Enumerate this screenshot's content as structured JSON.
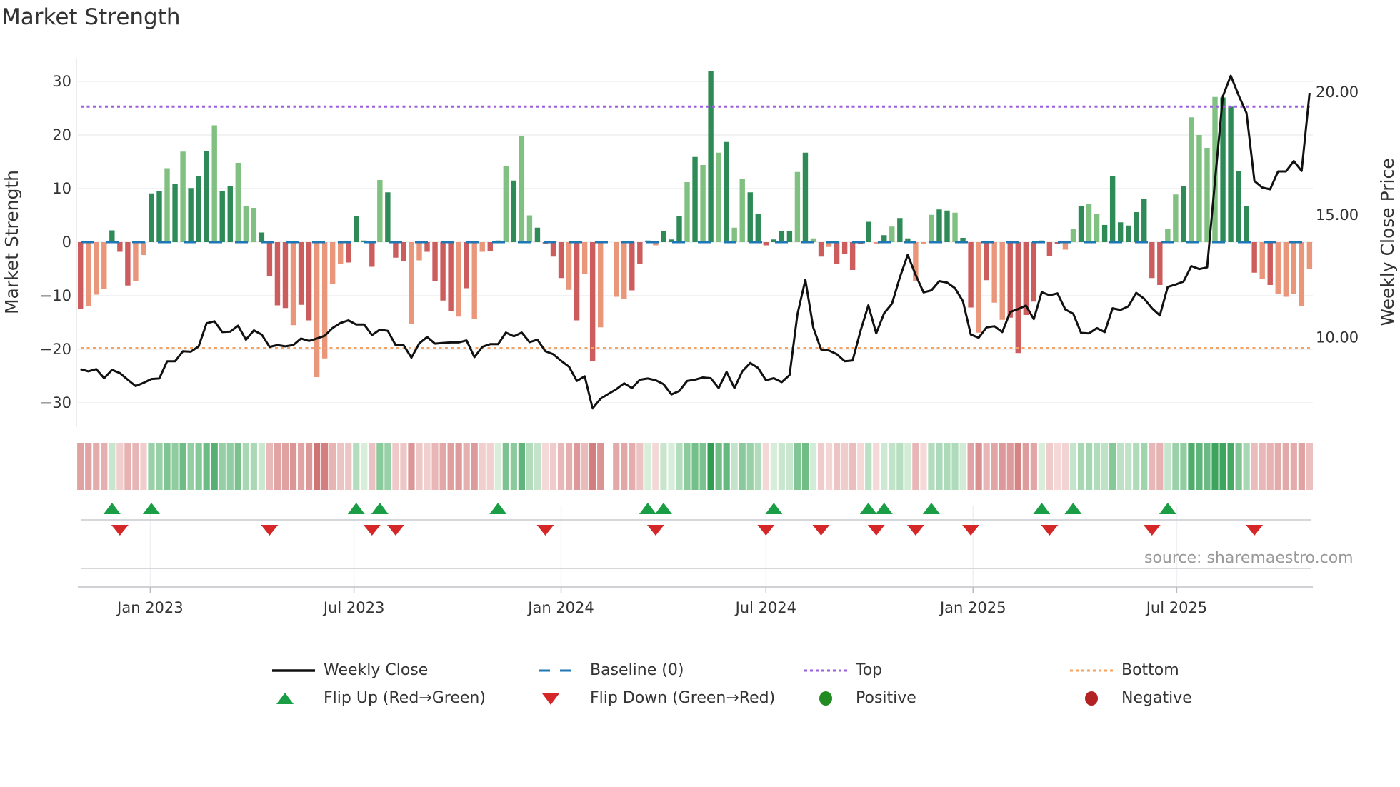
{
  "header": {
    "title": "Market Strength"
  },
  "source": "source: sharemaestro.com",
  "colors": {
    "pos_dark": "#2e8b57",
    "pos_light": "#80c080",
    "neg_dark": "#cd5c5c",
    "neg_light": "#e9967a",
    "price": "#111111",
    "baseline": "#1f77b4",
    "top": "#9b5fe0",
    "bottom": "#f4a261",
    "flip_up": "#1a9e45",
    "flip_down": "#d62728",
    "positive": "#228b22",
    "negative": "#b22222"
  },
  "legend": {
    "weekly_close": "Weekly Close",
    "baseline": "Baseline (0)",
    "top": "Top",
    "bottom": "Bottom",
    "flip_up": "Flip Up (Red→Green)",
    "flip_down": "Flip Down (Green→Red)",
    "positive": "Positive",
    "negative": "Negative"
  },
  "chart_data": {
    "type": "bar",
    "title": "Market Strength",
    "ylabel": "Market Strength",
    "y2label": "Weekly Close Price",
    "ylim": [
      -33,
      33
    ],
    "y2lim": [
      6.4,
      21.5
    ],
    "yticks": [
      30,
      20,
      10,
      0,
      -10,
      -20,
      -30
    ],
    "y2ticks": [
      "20.00",
      "15.00",
      "10.00"
    ],
    "x_start": "2022-10-31",
    "x_interval_days": 7,
    "xticks": [
      {
        "date": "2023-01-01",
        "label": "Jan 2023"
      },
      {
        "date": "2023-07-01",
        "label": "Jul 2023"
      },
      {
        "date": "2024-01-01",
        "label": "Jan 2024"
      },
      {
        "date": "2024-07-01",
        "label": "Jul 2024"
      },
      {
        "date": "2025-01-01",
        "label": "Jan 2025"
      },
      {
        "date": "2025-07-01",
        "label": "Jul 2025"
      }
    ],
    "top_level": 25.3,
    "bottom_level": -19.8,
    "baseline": 0,
    "strength": [
      -12.4,
      -11.9,
      -9.8,
      -8.8,
      2.2,
      -1.8,
      -8.1,
      -7.3,
      -2.4,
      9.1,
      9.5,
      13.8,
      10.8,
      16.9,
      10.1,
      12.4,
      17.0,
      21.8,
      9.6,
      10.5,
      14.8,
      6.8,
      6.4,
      1.8,
      -6.4,
      -11.8,
      -12.3,
      -15.5,
      -11.7,
      -14.6,
      -25.2,
      -21.7,
      -7.8,
      -4.1,
      -3.8,
      4.9,
      0.3,
      -4.6,
      11.6,
      9.3,
      -2.9,
      -3.6,
      -15.2,
      -3.4,
      -1.8,
      -7.2,
      -10.9,
      -12.9,
      -13.9,
      -8.6,
      -14.3,
      -1.8,
      -1.7,
      0.3,
      14.2,
      11.5,
      19.8,
      5.0,
      2.7,
      -0.3,
      -2.7,
      -6.7,
      -8.9,
      -14.6,
      -6.0,
      -22.2,
      -15.9,
      null,
      -10.2,
      -10.6,
      -9.0,
      -4.0,
      0.3,
      -0.6,
      2.1,
      0.5,
      4.8,
      11.2,
      15.9,
      14.4,
      31.9,
      16.7,
      18.7,
      2.7,
      11.8,
      9.3,
      5.2,
      -0.6,
      0.5,
      2.0,
      2.0,
      13.1,
      16.7,
      0.7,
      -2.7,
      -0.9,
      -4.0,
      -2.2,
      -5.2,
      -0.3,
      3.8,
      -0.4,
      1.3,
      2.9,
      4.5,
      0.7,
      -7.2,
      -0.3,
      5.1,
      6.1,
      5.9,
      5.5,
      0.8,
      -12.2,
      -16.9,
      -7.1,
      -11.3,
      -14.5,
      -14.1,
      -20.7,
      -13.6,
      -11.1,
      0.3,
      -2.6,
      -0.3,
      -1.4,
      2.5,
      6.8,
      7.1,
      5.2,
      3.2,
      12.4,
      3.7,
      3.1,
      5.6,
      8.0,
      -6.7,
      -8.0,
      2.5,
      8.9,
      10.4,
      23.3,
      20.0,
      17.6,
      27.1,
      27.0,
      25.3,
      13.3,
      6.8,
      -5.7,
      -6.8,
      -8.0,
      -9.7,
      -10.2,
      -9.7,
      -12.0,
      -5.0
    ],
    "shade": "dllldddllddldldddlddlllddddlddllllddddldddllddddldllddldllddddldldldlldddldddldldldllddddddldldldddddldldd lllddlddldlldddddddlldllddddddddlldlllldddddldl",
    "weekly_close": [
      8.71,
      8.62,
      8.71,
      8.34,
      8.68,
      8.55,
      8.28,
      8.02,
      8.15,
      8.31,
      8.33,
      9.03,
      9.03,
      9.44,
      9.42,
      9.64,
      10.58,
      10.66,
      10.22,
      10.24,
      10.48,
      9.91,
      10.29,
      10.12,
      9.62,
      9.69,
      9.64,
      9.69,
      9.96,
      9.86,
      9.96,
      10.07,
      10.39,
      10.59,
      10.7,
      10.53,
      10.53,
      10.1,
      10.32,
      10.27,
      9.69,
      9.69,
      9.18,
      9.76,
      10.02,
      9.75,
      9.78,
      9.8,
      9.8,
      9.88,
      9.2,
      9.62,
      9.73,
      9.73,
      10.2,
      10.05,
      10.2,
      9.81,
      9.91,
      9.44,
      9.32,
      9.05,
      8.81,
      8.23,
      8.42,
      7.11,
      7.5,
      7.7,
      7.89,
      8.13,
      7.94,
      8.28,
      8.33,
      8.26,
      8.1,
      7.68,
      7.82,
      8.23,
      8.28,
      8.37,
      8.34,
      7.94,
      8.6,
      7.94,
      8.62,
      8.96,
      8.76,
      8.26,
      8.34,
      8.18,
      8.47,
      10.95,
      12.35,
      10.41,
      9.51,
      9.47,
      9.32,
      9.03,
      9.06,
      10.27,
      11.31,
      10.17,
      10.99,
      11.38,
      12.45,
      13.37,
      12.55,
      11.84,
      11.92,
      12.3,
      12.24,
      12.01,
      11.48,
      10.12,
      9.99,
      10.41,
      10.46,
      10.22,
      11.04,
      11.16,
      11.3,
      10.75,
      11.85,
      11.72,
      11.8,
      11.14,
      10.97,
      10.19,
      10.17,
      10.38,
      10.22,
      11.19,
      11.12,
      11.27,
      11.82,
      11.58,
      11.19,
      10.9,
      12.06,
      12.16,
      12.28,
      12.91,
      12.79,
      12.86,
      16.38,
      19.83,
      20.67,
      19.87,
      19.15,
      16.38,
      16.11,
      16.04,
      16.77,
      16.77,
      17.19,
      16.79,
      19.97
    ],
    "grid": true,
    "legend_position": "bottom-center"
  }
}
